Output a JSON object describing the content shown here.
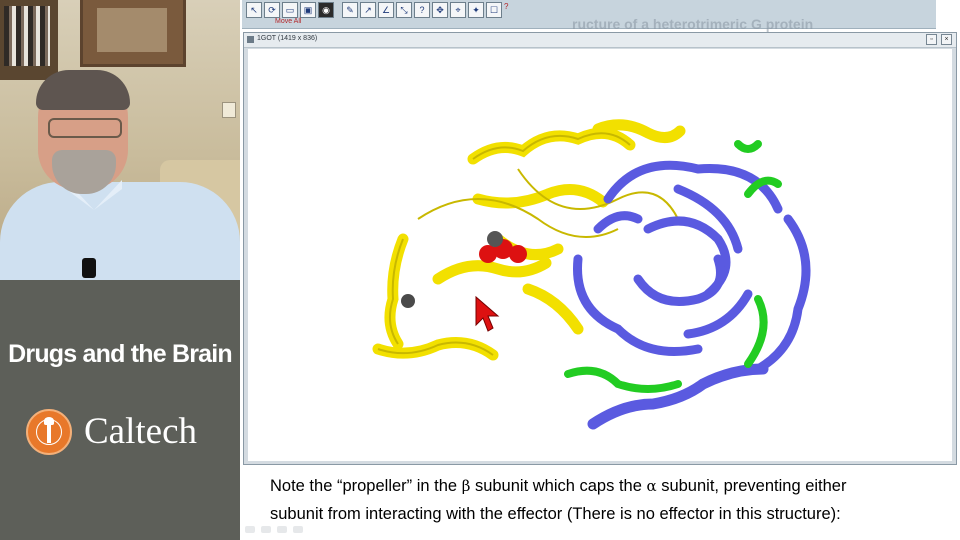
{
  "course": {
    "title": "Drugs and the Brain",
    "institution": "Caltech"
  },
  "toolbar": {
    "move_all_label": "Move All",
    "buttons": [
      "pointer-icon",
      "rotate-icon",
      "translate-icon",
      "zoom-icon",
      "center-icon",
      "label-icon",
      "distance-icon",
      "angle-icon",
      "torsion-icon",
      "question-icon",
      "move-icon",
      "measure-icon",
      "residue-icon",
      "select-icon",
      "help-icon"
    ],
    "background_text": "ructure of a heterotrimeric G protein"
  },
  "viewer": {
    "window_title": "1GOT  (1419 x 836)",
    "controls": [
      "restore",
      "close"
    ]
  },
  "structure": {
    "alpha_subunit_color": "#f2e000",
    "beta_subunit_color": "#5a5ae0",
    "gamma_subunit_color": "#22cc22",
    "ligand_color": "#dd1111",
    "cursor_color": "#dd1111"
  },
  "caption": {
    "line1_a": "Note the “propeller” in the ",
    "beta": "β",
    "line1_b": " subunit which caps the ",
    "alpha": "α",
    "line1_c": " subunit, preventing either",
    "line2": "subunit from interacting with the effector (There is no effector in this structure):"
  }
}
